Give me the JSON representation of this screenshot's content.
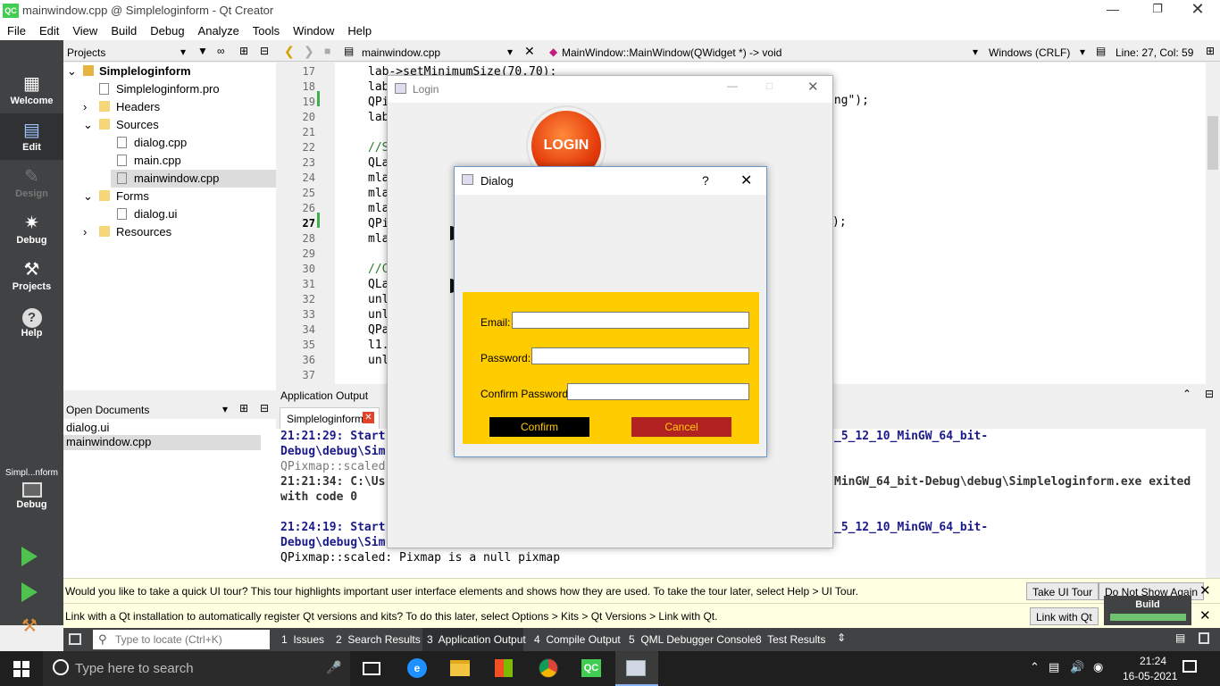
{
  "window": {
    "title": "mainwindow.cpp @ Simpleloginform - Qt Creator",
    "app_icon": "QC"
  },
  "menu": [
    "File",
    "Edit",
    "View",
    "Build",
    "Debug",
    "Analyze",
    "Tools",
    "Window",
    "Help"
  ],
  "modes": [
    {
      "label": "Welcome",
      "icon": "grid-icon"
    },
    {
      "label": "Edit",
      "icon": "document-icon"
    },
    {
      "label": "Design",
      "icon": "pencil-icon"
    },
    {
      "label": "Debug",
      "icon": "bug-icon"
    },
    {
      "label": "Projects",
      "icon": "wrench-icon"
    },
    {
      "label": "Help",
      "icon": "help-icon"
    }
  ],
  "kit": {
    "label": "Simpl...nform",
    "mode": "Debug"
  },
  "projects_panel": {
    "title": "Projects"
  },
  "tree": [
    {
      "label": "Simpleloginform",
      "depth": 0,
      "bold": true
    },
    {
      "label": "Simpleloginform.pro",
      "depth": 1
    },
    {
      "label": "Headers",
      "depth": 1
    },
    {
      "label": "Sources",
      "depth": 1
    },
    {
      "label": "dialog.cpp",
      "depth": 2
    },
    {
      "label": "main.cpp",
      "depth": 2
    },
    {
      "label": "mainwindow.cpp",
      "depth": 2,
      "selected": true
    },
    {
      "label": "Forms",
      "depth": 1
    },
    {
      "label": "dialog.ui",
      "depth": 2
    },
    {
      "label": "Resources",
      "depth": 1
    }
  ],
  "editor_toolbar": {
    "file": "mainwindow.cpp",
    "symbol": "MainWindow::MainWindow(QWidget *) -> void",
    "line_ending": "Windows (CRLF)",
    "position": "Line: 27, Col: 59"
  },
  "code_lines": [
    {
      "n": "17",
      "t": "lab->setMinimumSize(70,70);"
    },
    {
      "n": "18",
      "t": "lab"
    },
    {
      "n": "19",
      "t": "QPi"
    },
    {
      "n": "20",
      "t": "lab"
    },
    {
      "n": "21",
      "t": ""
    },
    {
      "n": "22",
      "t": "//S"
    },
    {
      "n": "23",
      "t": "QLa"
    },
    {
      "n": "24",
      "t": "mla"
    },
    {
      "n": "25",
      "t": "mla"
    },
    {
      "n": "26",
      "t": "mla"
    },
    {
      "n": "27",
      "t": "QPi"
    },
    {
      "n": "28",
      "t": "mla"
    },
    {
      "n": "29",
      "t": ""
    },
    {
      "n": "30",
      "t": "//C"
    },
    {
      "n": "31",
      "t": "QLa"
    },
    {
      "n": "32",
      "t": "unl"
    },
    {
      "n": "33",
      "t": "unl"
    },
    {
      "n": "34",
      "t": "QPa"
    },
    {
      "n": "35",
      "t": "l1."
    },
    {
      "n": "36",
      "t": "unl"
    },
    {
      "n": "37",
      "t": ""
    }
  ],
  "code_tail_19": "png\");",
  "code_tail_27": ");",
  "open_documents": {
    "title": "Open Documents",
    "items": [
      "dialog.ui",
      "mainwindow.cpp"
    ]
  },
  "app_output": {
    "title": "Application Output",
    "tab": "Simpleloginform",
    "lines": [
      {
        "t": "21:21:29: Start",
        "bold": true,
        "color": "#1a1a8a"
      },
      {
        "t": "Debug\\debug\\Sim",
        "bold": true,
        "color": "#1a1a8a"
      },
      {
        "t": "QPixmap::scaled",
        "color": "#7a7a7a"
      },
      {
        "t": "21:21:34: C:\\Us",
        "bold": true,
        "color": "#333"
      },
      {
        "t": "with code 0",
        "bold": true,
        "color": "#333"
      },
      {
        "t": "",
        "color": "#000"
      },
      {
        "t": "21:24:19: Start",
        "bold": true,
        "color": "#1a1a8a"
      },
      {
        "t": "Debug\\debug\\Sim",
        "bold": true,
        "color": "#1a1a8a"
      },
      {
        "t": "QPixmap::scaled: Pixmap is a null pixmap",
        "color": "#000"
      }
    ],
    "right_lines": [
      {
        "t": "_5_12_10_MinGW_64_bit-",
        "bold": true,
        "color": "#1a1a8a"
      },
      {
        "t": "MinGW_64_bit-Debug\\debug\\Simpleloginform.exe exited",
        "bold": true,
        "color": "#333"
      },
      {
        "t": "_5_12_10_MinGW_64_bit-",
        "bold": true,
        "color": "#1a1a8a"
      }
    ]
  },
  "tour_bar": {
    "text": "Would you like to take a quick UI tour? This tour highlights important user interface elements and shows how they are used. To take the tour later, select Help > UI Tour.",
    "btn1": "Take UI Tour",
    "btn2": "Do Not Show Again"
  },
  "link_bar": {
    "text": "Link with a Qt installation to automatically register Qt versions and kits? To do this later, select Options > Kits > Qt Versions > Link with Qt.",
    "btn1": "Link with Qt"
  },
  "build_popup": {
    "label": "Build"
  },
  "status": {
    "locate_placeholder": "Type to locate (Ctrl+K)",
    "tabs": [
      "1  Issues",
      "2  Search Results",
      "3  Application Output",
      "4  Compile Output",
      "5  QML Debugger Console",
      "8  Test Results"
    ]
  },
  "login_window": {
    "title": "Login",
    "logo_text": "LOGIN"
  },
  "dialog": {
    "title": "Dialog",
    "help": "?",
    "email_label": "Email:",
    "password_label": "Password:",
    "confirm_label": "Confirm Password:",
    "confirm_btn": "Confirm",
    "cancel_btn": "Cancel",
    "form_color": "#ffcc00",
    "confirm_color": "#000000",
    "cancel_color": "#b22222"
  },
  "taskbar": {
    "search_placeholder": "Type here to search",
    "time": "21:24",
    "date": "16-05-2021",
    "pinned": [
      "task-view-icon",
      "edge-icon",
      "file-explorer-icon",
      "store-icon",
      "chrome-icon",
      "qt-creator-icon",
      "app-window-icon"
    ]
  }
}
